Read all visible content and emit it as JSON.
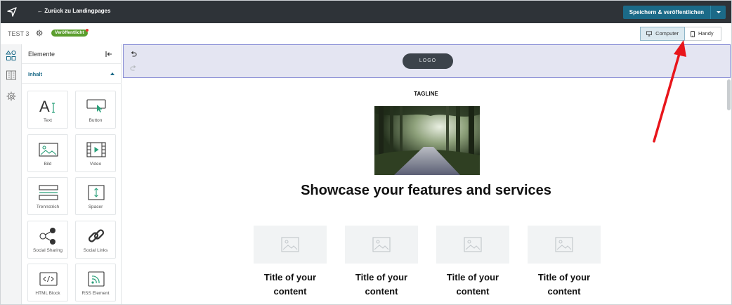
{
  "topbar": {
    "back_label": "← Zurück zu Landingpages",
    "publish_label": "Speichern & veröffentlichen"
  },
  "subbar": {
    "page_name": "TEST 3",
    "status": "Veröffentlicht",
    "devices": [
      {
        "label": "Computer",
        "active": true
      },
      {
        "label": "Handy",
        "active": false
      }
    ]
  },
  "panel": {
    "title": "Elemente",
    "section": "Inhalt",
    "tiles": [
      {
        "label": "Text",
        "icon": "text-icon"
      },
      {
        "label": "Button",
        "icon": "button-icon"
      },
      {
        "label": "Bild",
        "icon": "image-icon"
      },
      {
        "label": "Video",
        "icon": "video-icon"
      },
      {
        "label": "Trennstrich",
        "icon": "divider-icon"
      },
      {
        "label": "Spacer",
        "icon": "spacer-icon"
      },
      {
        "label": "Social Sharing",
        "icon": "share-icon"
      },
      {
        "label": "Social Links",
        "icon": "link-icon"
      },
      {
        "label": "HTML Block",
        "icon": "code-icon"
      },
      {
        "label": "RSS Element",
        "icon": "rss-icon"
      }
    ]
  },
  "canvas": {
    "logo": "LOGO",
    "tagline": "TAGLINE",
    "headline": "Showcase your features and services",
    "cards": [
      {
        "title": "Title of your content"
      },
      {
        "title": "Title of your content"
      },
      {
        "title": "Title of your content"
      },
      {
        "title": "Title of your content"
      }
    ]
  },
  "colors": {
    "topbar": "#2e3338",
    "accent": "#1b6a88",
    "status_green": "#5b9e2e",
    "header_band": "#e4e5f2",
    "annotation_arrow": "#e8151b"
  }
}
